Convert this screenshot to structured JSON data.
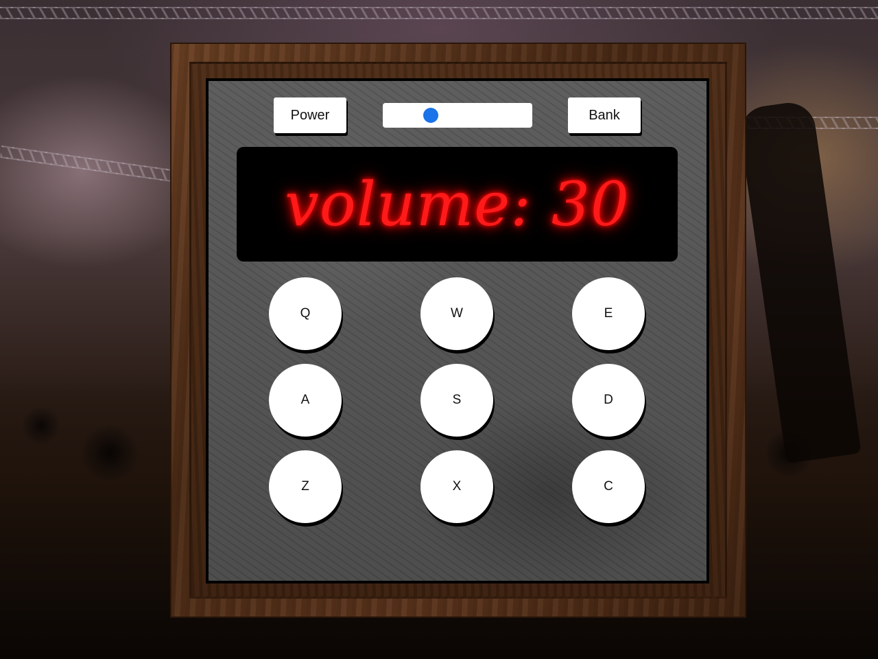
{
  "controls": {
    "power_label": "Power",
    "bank_label": "Bank",
    "volume": 30
  },
  "display": {
    "text": "volume: 30",
    "color": "#ff1a1a"
  },
  "pads": [
    {
      "key": "Q"
    },
    {
      "key": "W"
    },
    {
      "key": "E"
    },
    {
      "key": "A"
    },
    {
      "key": "S"
    },
    {
      "key": "D"
    },
    {
      "key": "Z"
    },
    {
      "key": "X"
    },
    {
      "key": "C"
    }
  ],
  "colors": {
    "accent": "#1a73e8",
    "display_glow": "#ff0000",
    "frame_wood": "#5a331b"
  }
}
